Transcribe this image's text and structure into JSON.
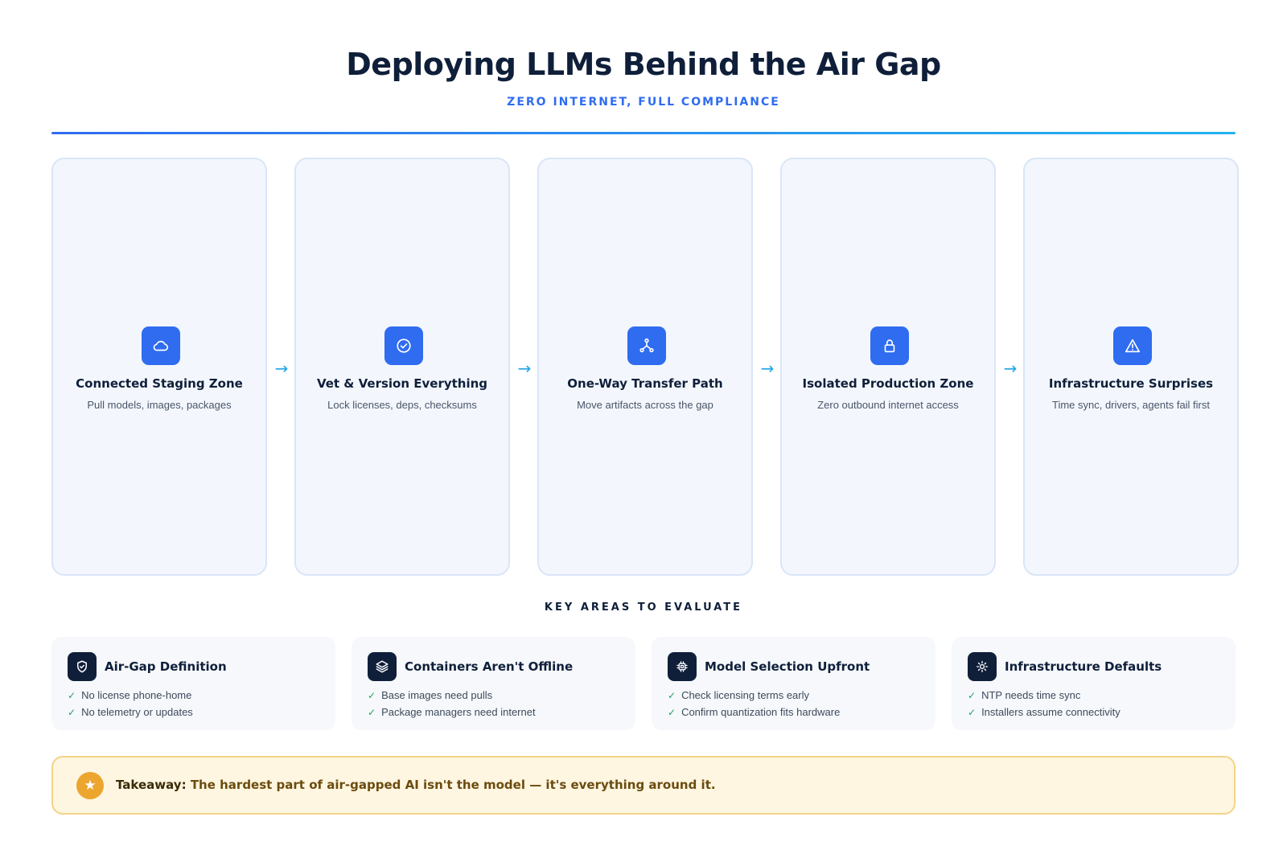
{
  "header": {
    "title": "Deploying LLMs Behind the Air Gap",
    "subtitle": "ZERO INTERNET, FULL COMPLIANCE"
  },
  "stages": [
    {
      "icon": "cloud-icon",
      "title": "Connected Staging Zone",
      "description": "Pull models, images, packages"
    },
    {
      "icon": "check-circle-icon",
      "title": "Vet & Version Everything",
      "description": "Lock licenses, deps, checksums"
    },
    {
      "icon": "share-nodes-icon",
      "title": "One-Way Transfer Path",
      "description": "Move artifacts across the gap"
    },
    {
      "icon": "lock-icon",
      "title": "Isolated Production Zone",
      "description": "Zero outbound internet access"
    },
    {
      "icon": "warning-triangle-icon",
      "title": "Infrastructure Surprises",
      "description": "Time sync, drivers, agents fail first"
    }
  ],
  "arrows": [
    "→",
    "→",
    "→",
    "→"
  ],
  "key_areas": {
    "heading": "KEY AREAS TO EVALUATE",
    "items": [
      {
        "icon": "shield-check-icon",
        "title": "Air-Gap Definition",
        "points": [
          "No license phone-home",
          "No telemetry or updates"
        ]
      },
      {
        "icon": "layers-icon",
        "title": "Containers Aren't Offline",
        "points": [
          "Base images need pulls",
          "Package managers need internet"
        ]
      },
      {
        "icon": "chip-icon",
        "title": "Model Selection Upfront",
        "points": [
          "Check licensing terms early",
          "Confirm quantization fits hardware"
        ]
      },
      {
        "icon": "sun-gear-icon",
        "title": "Infrastructure Defaults",
        "points": [
          "NTP needs time sync",
          "Installers assume connectivity"
        ]
      }
    ],
    "check_glyph": "✓"
  },
  "takeaway": {
    "icon": "star-icon",
    "star_glyph": "★",
    "label": "Takeaway:",
    "text": " The hardest part of air-gapped AI isn't the model — it's everything around it."
  },
  "colors": {
    "accent": "#2f6cf0",
    "navy": "#0f1f3a",
    "check": "#1fa35b",
    "takeaway_bg": "#fef6e0",
    "star": "#eca52f"
  }
}
